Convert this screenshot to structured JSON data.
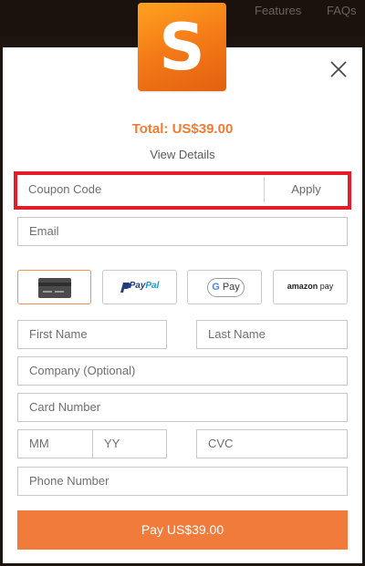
{
  "nav": {
    "features": "Features",
    "faqs": "FAQs"
  },
  "logo": {
    "letter": "S",
    "icon": "app-logo-icon"
  },
  "total": "Total: US$39.00",
  "view_details": "View Details",
  "coupon": {
    "placeholder": "Coupon Code",
    "apply": "Apply"
  },
  "email": {
    "placeholder": "Email"
  },
  "payment_methods": {
    "card": "card-icon",
    "paypal": {
      "pay": "Pay",
      "pal": "Pal"
    },
    "gpay": {
      "g": "G",
      "label": "Pay"
    },
    "amazon": {
      "brand": "amazon",
      "suffix": "pay"
    }
  },
  "form": {
    "first_name": "First Name",
    "last_name": "Last Name",
    "company": "Company (Optional)",
    "card_number": "Card Number",
    "mm": "MM",
    "yy": "YY",
    "cvc": "CVC",
    "phone": "Phone Number"
  },
  "pay_button": "Pay US$39.00",
  "colors": {
    "accent": "#f07b3a",
    "highlight": "#e21d2c"
  }
}
